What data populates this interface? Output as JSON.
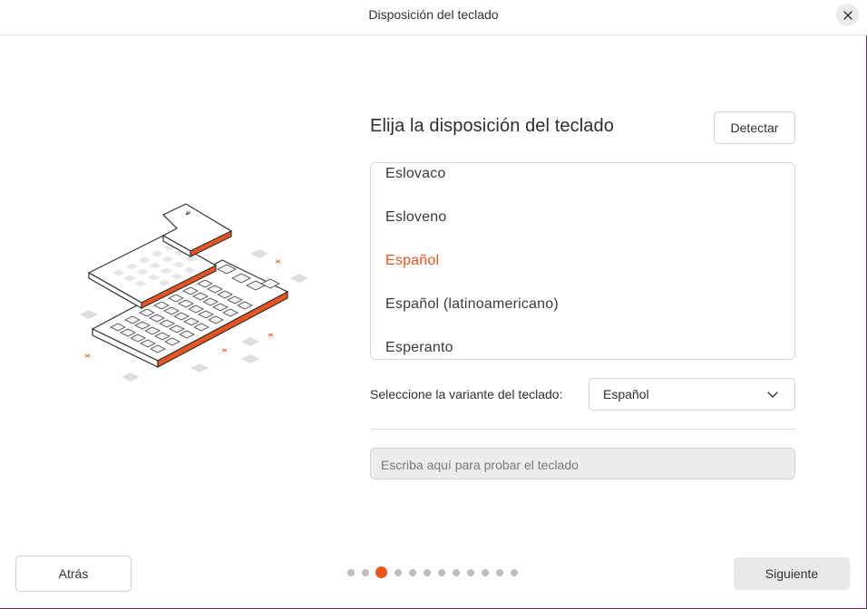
{
  "window": {
    "title": "Disposición del teclado",
    "close_icon": "close-icon"
  },
  "main": {
    "heading": "Elija la disposición del teclado",
    "detect_label": "Detectar",
    "layouts": [
      {
        "label": "Eslovaco",
        "selected": false
      },
      {
        "label": "Esloveno",
        "selected": false
      },
      {
        "label": "Español",
        "selected": true
      },
      {
        "label": "Español (latinoamericano)",
        "selected": false
      },
      {
        "label": "Esperanto",
        "selected": false
      }
    ],
    "variant_label": "Seleccione la variante del teclado:",
    "variant_value": "Español",
    "test_placeholder": "Escriba aquí para probar el teclado"
  },
  "footer": {
    "back_label": "Atrás",
    "next_label": "Siguiente",
    "pages_total": 12,
    "current_page": 3
  },
  "colors": {
    "accent": "#e95420",
    "illustration_accent": "#e95420"
  }
}
